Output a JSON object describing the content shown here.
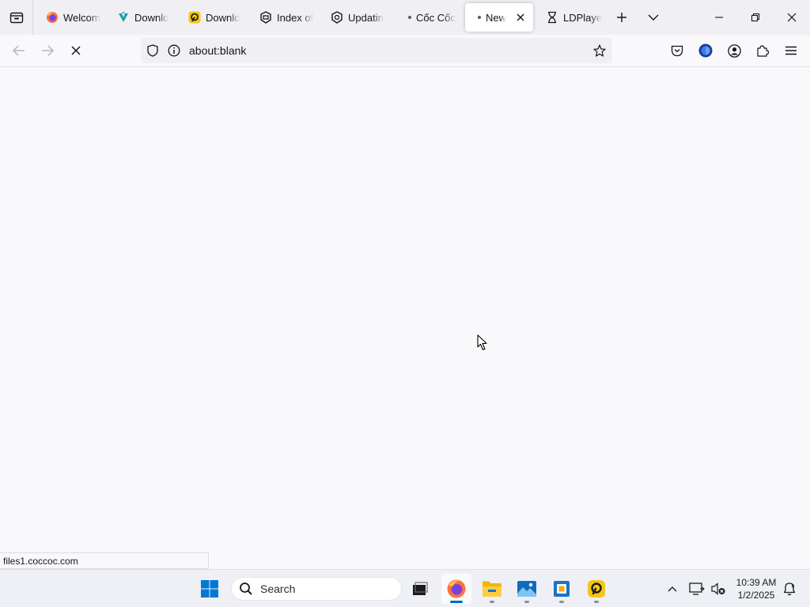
{
  "browser": {
    "tabs": [
      {
        "title": "Welcom",
        "icon": "firefox-icon"
      },
      {
        "title": "Downlo",
        "icon": "coccoc-download-icon"
      },
      {
        "title": "Downlo",
        "icon": "ldplayer-icon"
      },
      {
        "title": "Index of",
        "icon": "index-page-icon"
      },
      {
        "title": "Updatin",
        "icon": "updating-icon"
      },
      {
        "title": "Cốc Cốc",
        "icon": "loading-dot"
      },
      {
        "title": "New",
        "icon": "loading-dot",
        "active": true
      },
      {
        "title": "LDPlaye",
        "icon": "hourglass-icon"
      }
    ],
    "url": "about:blank",
    "status_url": "files1.coccoc.com"
  },
  "taskbar": {
    "search_label": "Search",
    "time": "10:39 AM",
    "date": "1/2/2025",
    "apps": [
      "task-view-icon",
      "firefox-icon",
      "file-explorer-icon",
      "photos-icon",
      "virtualbox-icon",
      "ldplayer-icon"
    ]
  },
  "colors": {
    "accent": "#0067c0",
    "tabstrip_bg": "#f0f0f4",
    "content_bg": "#f9f9fb"
  }
}
